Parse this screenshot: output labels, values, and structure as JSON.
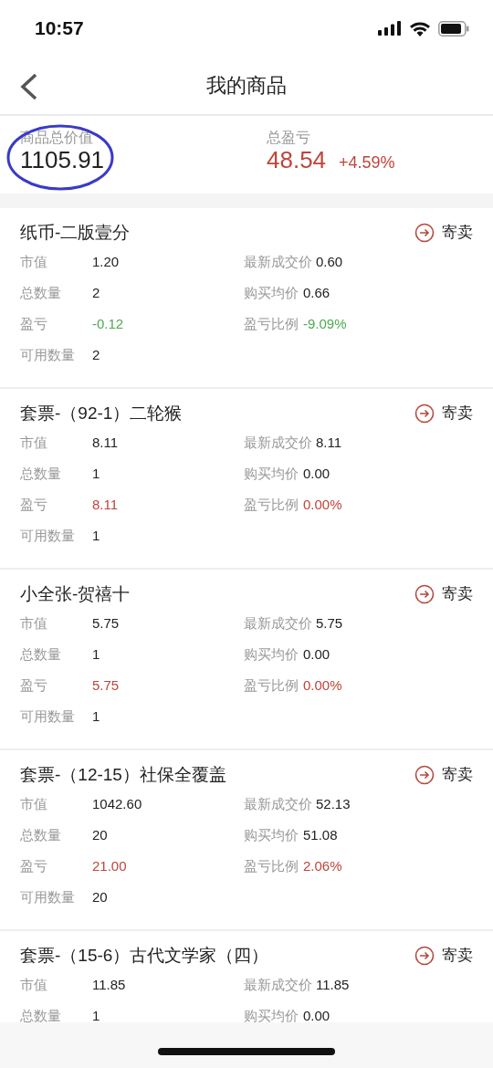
{
  "status_bar": {
    "time": "10:57"
  },
  "nav": {
    "title": "我的商品"
  },
  "summary": {
    "total_label": "商品总价值",
    "total_value": "1105.91",
    "total_circled": true,
    "profit_label": "总盈亏",
    "profit_value": "48.54",
    "profit_percent": "+4.59%"
  },
  "items": [
    {
      "name": "纸币-二版壹分",
      "action": "寄卖",
      "fields": [
        {
          "label": "市值",
          "value": "1.20"
        },
        {
          "label": "最新成交价",
          "value": "0.60"
        },
        {
          "label": "总数量",
          "value": "2"
        },
        {
          "label": "购买均价",
          "value": "0.66"
        },
        {
          "label": "盈亏",
          "value": "-0.12",
          "color": "#4caa52"
        },
        {
          "label": "盈亏比例",
          "value": "-9.09%",
          "color": "#4caa52"
        },
        {
          "label": "可用数量",
          "value": "2"
        }
      ]
    },
    {
      "name": "套票-（92-1）二轮猴",
      "action": "寄卖",
      "fields": [
        {
          "label": "市值",
          "value": "8.11"
        },
        {
          "label": "最新成交价",
          "value": "8.11"
        },
        {
          "label": "总数量",
          "value": "1"
        },
        {
          "label": "购买均价",
          "value": "0.00"
        },
        {
          "label": "盈亏",
          "value": "8.11",
          "color": "#c0443a"
        },
        {
          "label": "盈亏比例",
          "value": "0.00%",
          "color": "#c0443a"
        },
        {
          "label": "可用数量",
          "value": "1"
        }
      ]
    },
    {
      "name": "小全张-贺禧十",
      "action": "寄卖",
      "fields": [
        {
          "label": "市值",
          "value": "5.75"
        },
        {
          "label": "最新成交价",
          "value": "5.75"
        },
        {
          "label": "总数量",
          "value": "1"
        },
        {
          "label": "购买均价",
          "value": "0.00"
        },
        {
          "label": "盈亏",
          "value": "5.75",
          "color": "#c0443a"
        },
        {
          "label": "盈亏比例",
          "value": "0.00%",
          "color": "#c0443a"
        },
        {
          "label": "可用数量",
          "value": "1"
        }
      ]
    },
    {
      "name": "套票-（12-15）社保全覆盖",
      "action": "寄卖",
      "fields": [
        {
          "label": "市值",
          "value": "1042.60"
        },
        {
          "label": "最新成交价",
          "value": "52.13"
        },
        {
          "label": "总数量",
          "value": "20"
        },
        {
          "label": "购买均价",
          "value": "51.08"
        },
        {
          "label": "盈亏",
          "value": "21.00",
          "color": "#c0443a"
        },
        {
          "label": "盈亏比例",
          "value": "2.06%",
          "color": "#c0443a"
        },
        {
          "label": "可用数量",
          "value": "20"
        }
      ]
    },
    {
      "name": "套票-（15-6）古代文学家（四）",
      "action": "寄卖",
      "fields": [
        {
          "label": "市值",
          "value": "11.85"
        },
        {
          "label": "最新成交价",
          "value": "11.85"
        },
        {
          "label": "总数量",
          "value": "1"
        },
        {
          "label": "购买均价",
          "value": "0.00"
        }
      ]
    }
  ]
}
